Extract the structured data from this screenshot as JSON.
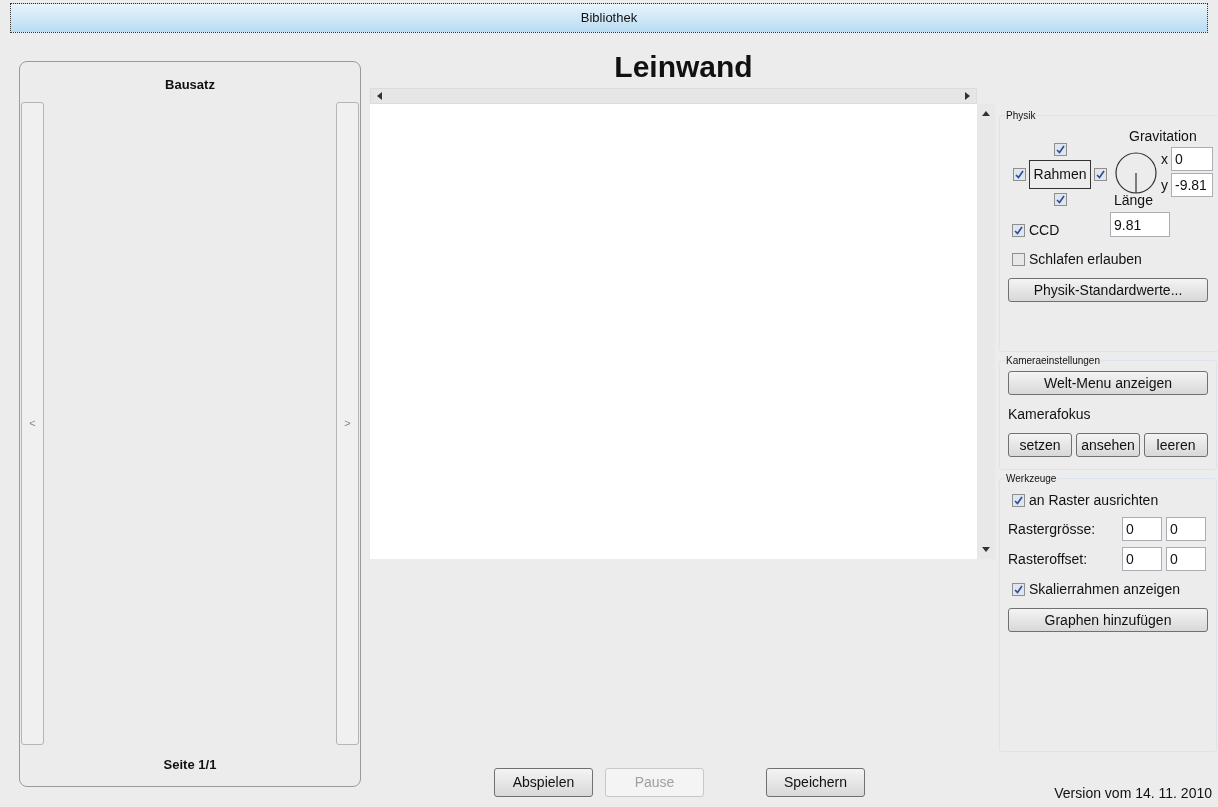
{
  "library_button": "Bibliothek",
  "kit": {
    "title": "Bausatz",
    "prev": "<",
    "next": ">",
    "page": "Seite 1/1"
  },
  "canvas": {
    "title": "Leinwand"
  },
  "physics": {
    "title": "Physik",
    "frame_label": "Rahmen",
    "walls": {
      "top": true,
      "left": true,
      "right": true,
      "bottom": true
    },
    "gravity_label": "Gravitation",
    "x_label": "x",
    "x_value": "0",
    "y_label": "y",
    "y_value": "-9.81",
    "length_label": "Länge",
    "length_value": "9.81",
    "options": [
      {
        "label": "CCD",
        "checked": true
      },
      {
        "label": "Schlafen erlauben",
        "checked": false
      }
    ],
    "defaults_button": "Physik-Standardwerte..."
  },
  "camera": {
    "title": "Kameraeinstellungen",
    "world_menu_button": "Welt-Menu anzeigen",
    "focus_label": "Kamerafokus",
    "focus_buttons": [
      "setzen",
      "ansehen",
      "leeren"
    ]
  },
  "tools": {
    "title": "Werkzeuge",
    "snap": {
      "label": "an Raster ausrichten",
      "checked": true
    },
    "grid_size": {
      "label": "Rastergrösse:",
      "values": [
        "0",
        "0"
      ]
    },
    "grid_offset": {
      "label": "Rasteroffset:",
      "values": [
        "0",
        "0"
      ]
    },
    "scale_frame": {
      "label": "Skalierrahmen anzeigen",
      "checked": true
    },
    "graphs_button": "Graphen hinzufügen"
  },
  "controls": [
    {
      "label": "Abspielen",
      "disabled": false
    },
    {
      "label": "Pause",
      "disabled": true
    },
    {
      "label": "Speichern",
      "disabled": false
    }
  ],
  "version": "Version vom 14. 11. 2010"
}
